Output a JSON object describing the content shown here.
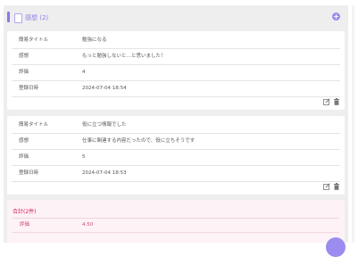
{
  "panel": {
    "title": "感想 (2)",
    "add_symbol": "+"
  },
  "cards": [
    {
      "rows": [
        {
          "label": "簡易タイトル",
          "value": "勉強になる"
        },
        {
          "label": "感想",
          "value": "もっと勉強しないと…と思いました！"
        },
        {
          "label": "評価",
          "value": "4"
        },
        {
          "label": "登録日時",
          "value": "2024-07-04 18:54"
        }
      ]
    },
    {
      "rows": [
        {
          "label": "簡易タイトル",
          "value": "役に立つ情報でした"
        },
        {
          "label": "感想",
          "value": "仕事に関連する内容だったので、役に立ちそうです"
        },
        {
          "label": "評価",
          "value": "5"
        },
        {
          "label": "登録日時",
          "value": "2024-07-04 18:53"
        }
      ]
    }
  ],
  "total": {
    "title": "合計(2件)",
    "label": "評価",
    "value": "4.50"
  },
  "colors": {
    "accent": "#8c7ae6",
    "total_text": "#d11a55",
    "total_background": "#fdf2f6"
  },
  "icons": [
    "file-icon",
    "add-icon",
    "edit-icon",
    "trash-icon"
  ]
}
